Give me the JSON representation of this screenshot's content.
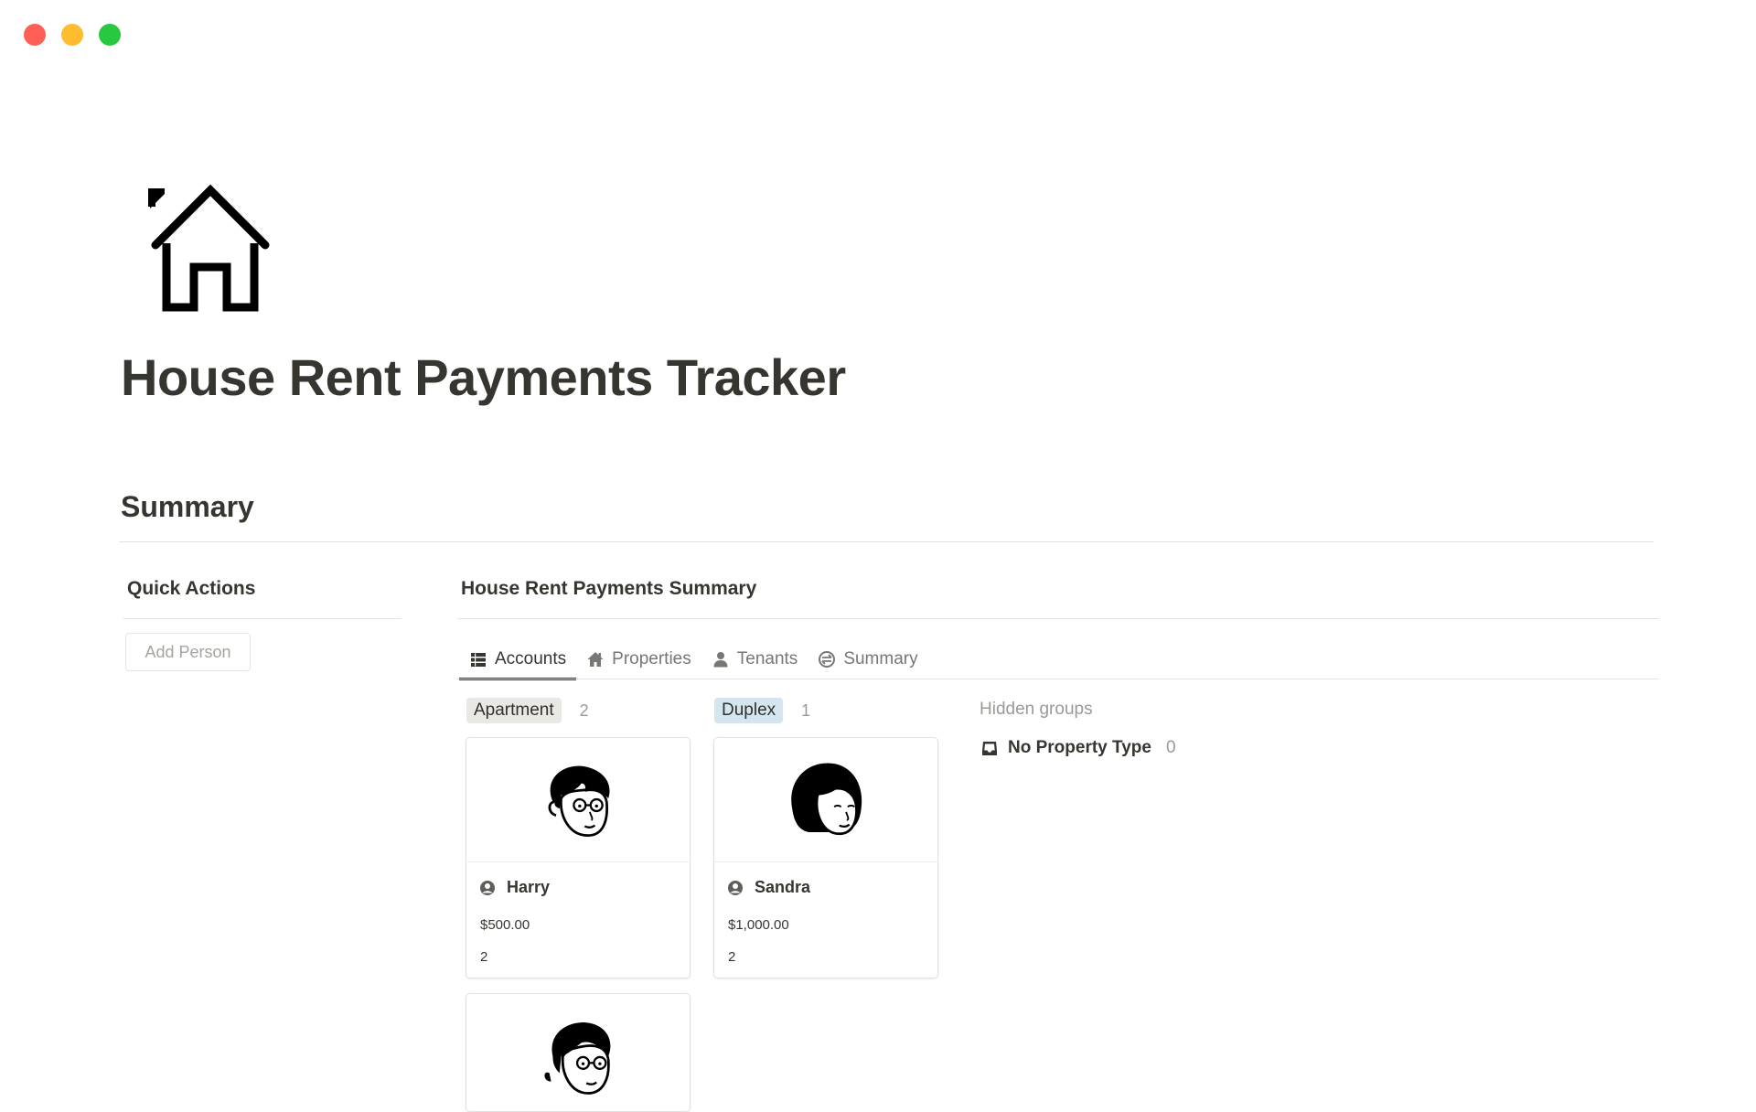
{
  "window": {
    "controls": [
      "close",
      "minimize",
      "zoom"
    ],
    "colors": {
      "close": "#fe5f57",
      "minimize": "#febc2e",
      "zoom": "#28c840"
    }
  },
  "page": {
    "icon": "house-icon",
    "title": "House Rent Payments Tracker",
    "section_heading": "Summary"
  },
  "quick_actions": {
    "title": "Quick Actions",
    "add_person_label": "Add Person"
  },
  "database": {
    "title": "House Rent Payments Summary",
    "tabs": [
      {
        "label": "Accounts",
        "icon": "table-icon",
        "active": true
      },
      {
        "label": "Properties",
        "icon": "home-icon",
        "active": false
      },
      {
        "label": "Tenants",
        "icon": "person-icon",
        "active": false
      },
      {
        "label": "Summary",
        "icon": "swap-circle-icon",
        "active": false
      }
    ],
    "groups": [
      {
        "name": "Apartment",
        "count": "2",
        "tag_color": "#e9e8e5",
        "cards": [
          {
            "name": "Harry",
            "amount": "$500.00",
            "count": "2",
            "avatar": "man-glasses-avatar"
          },
          {
            "name": "",
            "amount": "",
            "count": "",
            "avatar": "woman-glasses-avatar"
          }
        ]
      },
      {
        "name": "Duplex",
        "count": "1",
        "tag_color": "#d3e5ef",
        "cards": [
          {
            "name": "Sandra",
            "amount": "$1,000.00",
            "count": "2",
            "avatar": "woman-bob-avatar"
          }
        ]
      }
    ],
    "hidden_groups": {
      "label": "Hidden groups",
      "items": [
        {
          "name": "No Property Type",
          "count": "0",
          "icon": "inbox-icon"
        }
      ]
    }
  }
}
